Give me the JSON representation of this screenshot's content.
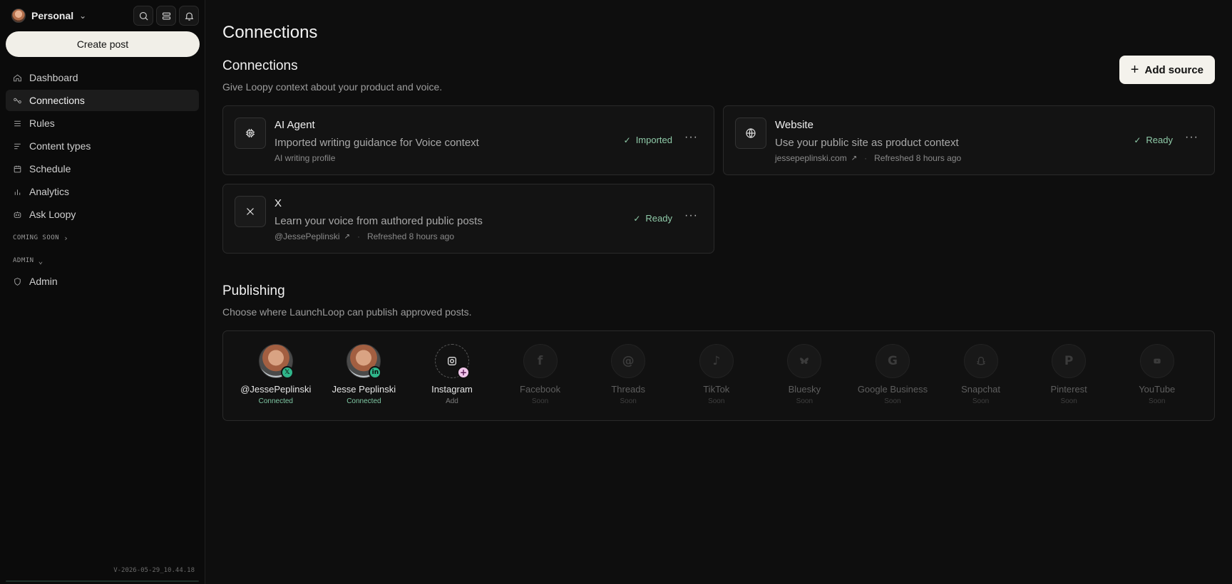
{
  "sidebar": {
    "workspace": "Personal",
    "create_post": "Create post",
    "nav": [
      {
        "label": "Dashboard",
        "icon": "home-icon"
      },
      {
        "label": "Connections",
        "icon": "link-icon"
      },
      {
        "label": "Rules",
        "icon": "list-icon"
      },
      {
        "label": "Content types",
        "icon": "content-icon"
      },
      {
        "label": "Schedule",
        "icon": "calendar-icon"
      },
      {
        "label": "Analytics",
        "icon": "bar-chart-icon"
      },
      {
        "label": "Ask Loopy",
        "icon": "robot-icon"
      }
    ],
    "coming_soon": "COMING SOON",
    "admin_section": "ADMIN",
    "admin_item": "Admin",
    "version": "V-2026-05-29_10.44.18"
  },
  "page": {
    "title": "Connections",
    "connections": {
      "title": "Connections",
      "subtitle": "Give Loopy context about your product and voice.",
      "add_source": "Add source",
      "cards": [
        {
          "title": "AI Agent",
          "desc": "Imported writing guidance for Voice context",
          "meta": "AI writing profile",
          "status": "Imported"
        },
        {
          "title": "Website",
          "desc": "Use your public site as product context",
          "meta_link": "jessepeplinski.com",
          "meta_refreshed": "Refreshed  8 hours ago",
          "status": "Ready"
        },
        {
          "title": "X",
          "desc": "Learn your voice from authored public posts",
          "meta_link": "@JessePeplinski",
          "meta_refreshed": "Refreshed  8 hours ago",
          "status": "Ready"
        }
      ]
    },
    "publishing": {
      "title": "Publishing",
      "subtitle": "Choose where LaunchLoop can publish approved posts.",
      "items": [
        {
          "name": "@JessePeplinski",
          "state": "Connected"
        },
        {
          "name": "Jesse Peplinski",
          "state": "Connected"
        },
        {
          "name": "Instagram",
          "state": "Add"
        },
        {
          "name": "Facebook",
          "state": "Soon"
        },
        {
          "name": "Threads",
          "state": "Soon"
        },
        {
          "name": "TikTok",
          "state": "Soon"
        },
        {
          "name": "Bluesky",
          "state": "Soon"
        },
        {
          "name": "Google Business",
          "state": "Soon"
        },
        {
          "name": "Snapchat",
          "state": "Soon"
        },
        {
          "name": "Pinterest",
          "state": "Soon"
        },
        {
          "name": "YouTube",
          "state": "Soon"
        }
      ]
    }
  },
  "colors": {
    "accent_green": "#8fcaa8",
    "background": "#0e0e0e"
  }
}
